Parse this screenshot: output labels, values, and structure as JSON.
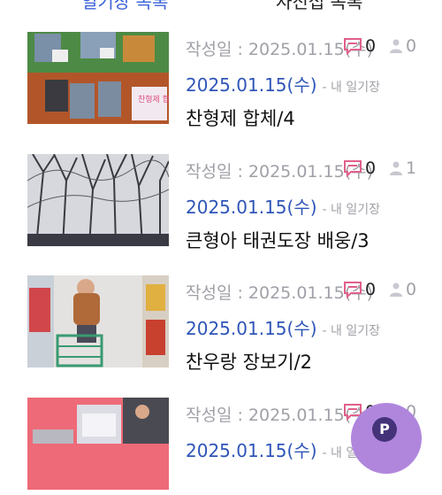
{
  "tabs": {
    "left_label": "일기장 목록",
    "right_label": "사진첩 목록"
  },
  "entries": [
    {
      "created": "작성일 : 2025.01.15(수)",
      "comments": "0",
      "likes": "0",
      "date": "2025.01.15(수)",
      "source": "- 내 일기장",
      "title": "찬형제 합체/4",
      "photo_caption": "찬형제 합체"
    },
    {
      "created": "작성일 : 2025.01.15(수)",
      "comments": "0",
      "likes": "1",
      "date": "2025.01.15(수)",
      "source": "- 내 일기장",
      "title": "큰형아 태권도장 배웅/3"
    },
    {
      "created": "작성일 : 2025.01.15(수)",
      "comments": "0",
      "likes": "0",
      "date": "2025.01.15(수)",
      "source": "- 내 일기장",
      "title": "찬우랑 장보기/2"
    },
    {
      "created": "작성일 : 2025.01.15(수)",
      "comments": "0",
      "likes": "0",
      "date": "2025.01.15(수)",
      "source": "- 내 일기장",
      "title": ""
    }
  ],
  "fab": {
    "label": "P"
  },
  "colors": {
    "accent": "#2f55b8",
    "muted": "#a0a0a8",
    "comment_icon": "#e0608a",
    "fab": "#b086dd"
  }
}
